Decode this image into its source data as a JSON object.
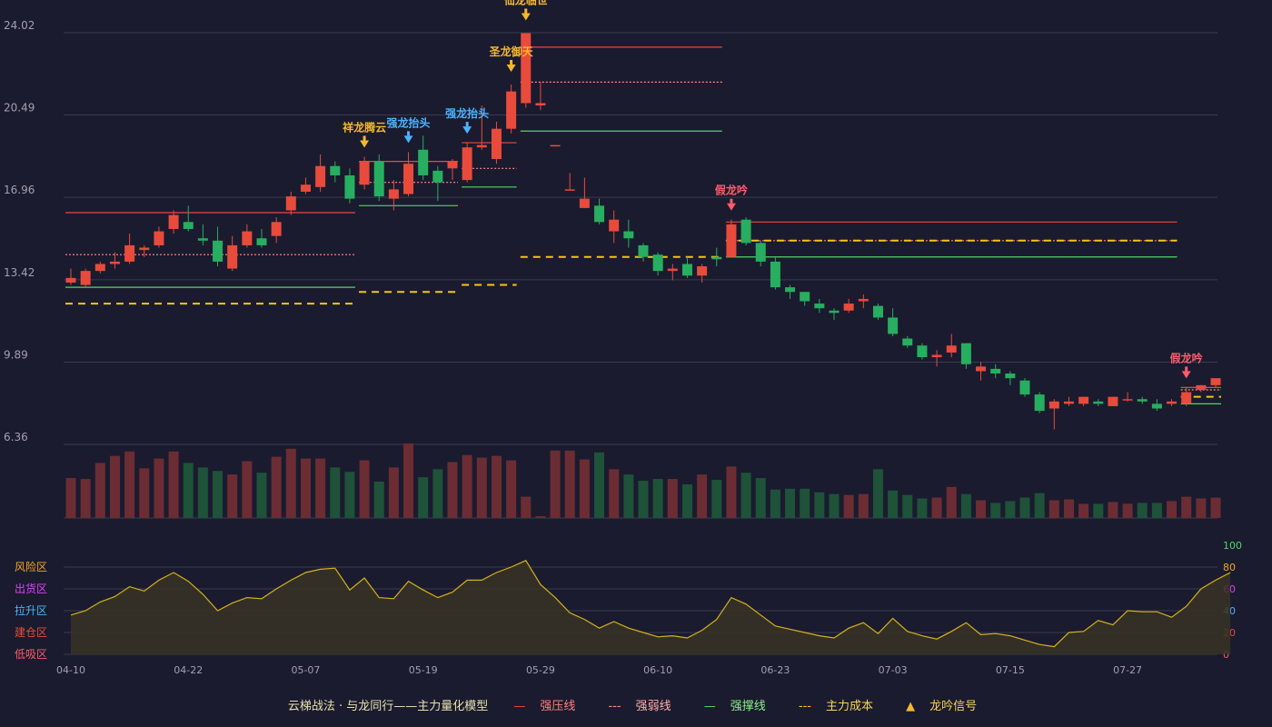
{
  "colors": {
    "background": "#1a1b2e",
    "up": "#e84b3c",
    "down": "#27ae60",
    "vol_up": "#6b2d33",
    "vol_down": "#1e5239",
    "pressure": "#e84b3c",
    "weak": "#ff8a8a",
    "support": "#4cd964",
    "cost": "#f5c518",
    "signal_gold": "#f5b82e",
    "signal_blue": "#4db2ff",
    "signal_red": "#ff5c6c",
    "osc_line": "#d4b21c",
    "grid": "#3a3b4e",
    "axis_text": "#a0a0b0"
  },
  "chart_data": {
    "type": "candlestick",
    "y_ticks": [
      "24.02",
      "20.49",
      "16.96",
      "13.42",
      "9.89",
      "6.36"
    ],
    "ylim": [
      6.36,
      24.02
    ],
    "x_labels": [
      {
        "index": 0,
        "label": "04-10"
      },
      {
        "index": 8,
        "label": "04-22"
      },
      {
        "index": 16,
        "label": "05-07"
      },
      {
        "index": 24,
        "label": "05-19"
      },
      {
        "index": 32,
        "label": "05-29"
      },
      {
        "index": 40,
        "label": "06-10"
      },
      {
        "index": 48,
        "label": "06-23"
      },
      {
        "index": 56,
        "label": "07-03"
      },
      {
        "index": 64,
        "label": "07-15"
      },
      {
        "index": 72,
        "label": "07-27"
      }
    ],
    "candles": [
      [
        13.3,
        13.5,
        13.9,
        13.2
      ],
      [
        13.2,
        13.8,
        13.9,
        13.1
      ],
      [
        13.8,
        14.1,
        14.2,
        13.7
      ],
      [
        14.1,
        14.2,
        14.6,
        13.9
      ],
      [
        14.2,
        14.9,
        15.4,
        14.1
      ],
      [
        14.7,
        14.8,
        14.9,
        14.4
      ],
      [
        14.9,
        15.5,
        15.7,
        14.8
      ],
      [
        15.6,
        16.2,
        16.4,
        15.4
      ],
      [
        15.9,
        15.6,
        16.6,
        15.5
      ],
      [
        15.2,
        15.1,
        15.8,
        14.9
      ],
      [
        15.1,
        14.2,
        15.7,
        14.0
      ],
      [
        13.9,
        14.9,
        15.3,
        13.8
      ],
      [
        14.9,
        15.5,
        15.8,
        14.8
      ],
      [
        15.2,
        14.9,
        15.6,
        14.8
      ],
      [
        15.3,
        15.9,
        16.1,
        15.0
      ],
      [
        16.4,
        17.0,
        17.2,
        16.2
      ],
      [
        17.2,
        17.5,
        17.8,
        17.1
      ],
      [
        17.4,
        18.3,
        18.8,
        17.2
      ],
      [
        18.3,
        17.9,
        18.5,
        17.6
      ],
      [
        17.9,
        16.9,
        18.2,
        16.7
      ],
      [
        17.5,
        18.5,
        18.7,
        17.3
      ],
      [
        18.5,
        17.0,
        18.8,
        16.8
      ],
      [
        16.9,
        17.3,
        17.7,
        16.4
      ],
      [
        17.1,
        18.4,
        18.9,
        17.0
      ],
      [
        19.0,
        17.9,
        19.6,
        17.7
      ],
      [
        18.1,
        17.6,
        18.3,
        16.8
      ],
      [
        18.2,
        18.5,
        18.6,
        17.7
      ],
      [
        17.7,
        19.1,
        19.3,
        17.6
      ],
      [
        19.1,
        19.2,
        20.9,
        19.0
      ],
      [
        18.6,
        19.9,
        20.2,
        18.4
      ],
      [
        19.9,
        21.5,
        21.8,
        19.7
      ],
      [
        21.0,
        24.0,
        24.0,
        20.8
      ],
      [
        20.9,
        21.0,
        21.9,
        20.7
      ],
      [
        19.2,
        19.2,
        19.2,
        19.2
      ],
      [
        17.3,
        17.3,
        18.0,
        17.3
      ],
      [
        16.5,
        16.9,
        17.8,
        16.5
      ],
      [
        16.6,
        15.9,
        16.9,
        15.8
      ],
      [
        15.5,
        16.0,
        16.4,
        15.0
      ],
      [
        15.5,
        15.2,
        16.0,
        14.8
      ],
      [
        14.9,
        14.4,
        15.0,
        14.2
      ],
      [
        14.5,
        13.8,
        14.6,
        13.6
      ],
      [
        13.8,
        13.9,
        14.1,
        13.4
      ],
      [
        14.1,
        13.6,
        14.4,
        13.5
      ],
      [
        13.6,
        14.0,
        14.1,
        13.3
      ],
      [
        14.4,
        14.3,
        14.8,
        14.0
      ],
      [
        14.4,
        15.8,
        16.0,
        14.4
      ],
      [
        16.0,
        15.0,
        16.1,
        14.9
      ],
      [
        15.0,
        14.2,
        15.1,
        14.0
      ],
      [
        14.2,
        13.1,
        14.4,
        13.0
      ],
      [
        13.1,
        12.9,
        13.2,
        12.6
      ],
      [
        12.9,
        12.5,
        12.9,
        12.3
      ],
      [
        12.4,
        12.2,
        12.6,
        12.0
      ],
      [
        12.1,
        12.0,
        12.2,
        11.7
      ],
      [
        12.1,
        12.4,
        12.6,
        12.0
      ],
      [
        12.5,
        12.6,
        12.8,
        12.2
      ],
      [
        12.3,
        11.8,
        12.4,
        11.7
      ],
      [
        11.8,
        11.1,
        12.2,
        11.0
      ],
      [
        10.9,
        10.6,
        11.0,
        10.5
      ],
      [
        10.6,
        10.1,
        10.7,
        10.0
      ],
      [
        10.1,
        10.2,
        10.4,
        9.7
      ],
      [
        10.3,
        10.6,
        11.1,
        10.1
      ],
      [
        10.7,
        9.8,
        10.7,
        9.6
      ],
      [
        9.5,
        9.7,
        9.9,
        9.1
      ],
      [
        9.6,
        9.4,
        9.8,
        9.2
      ],
      [
        9.4,
        9.2,
        9.5,
        8.9
      ],
      [
        9.1,
        8.5,
        9.2,
        8.4
      ],
      [
        8.5,
        7.8,
        8.6,
        7.7
      ],
      [
        7.9,
        8.2,
        8.3,
        7.0
      ],
      [
        8.1,
        8.2,
        8.4,
        8.0
      ],
      [
        8.1,
        8.4,
        8.4,
        8.0
      ],
      [
        8.2,
        8.1,
        8.3,
        8.0
      ],
      [
        8.0,
        8.4,
        8.4,
        8.0
      ],
      [
        8.3,
        8.3,
        8.6,
        8.2
      ],
      [
        8.3,
        8.2,
        8.4,
        8.1
      ],
      [
        8.1,
        7.9,
        8.3,
        7.8
      ],
      [
        8.1,
        8.2,
        8.3,
        8.0
      ],
      [
        8.1,
        8.6,
        8.8,
        8.0
      ],
      [
        8.7,
        8.9,
        8.9,
        8.6
      ],
      [
        8.9,
        9.2,
        9.2,
        8.8
      ]
    ],
    "volume": [
      45,
      44,
      62,
      70,
      75,
      56,
      67,
      75,
      62,
      57,
      53,
      49,
      64,
      51,
      69,
      78,
      67,
      67,
      57,
      52,
      65,
      41,
      57,
      84,
      46,
      55,
      63,
      71,
      68,
      70,
      65,
      24,
      2,
      76,
      76,
      66,
      74,
      55,
      49,
      42,
      44,
      44,
      38,
      49,
      43,
      58,
      51,
      45,
      32,
      33,
      33,
      29,
      27,
      26,
      27,
      55,
      31,
      26,
      22,
      23,
      35,
      27,
      20,
      17,
      19,
      23,
      28,
      20,
      21,
      16,
      16,
      18,
      16,
      17,
      17,
      19,
      24,
      22,
      23
    ],
    "oscillator": [
      36,
      40,
      48,
      53,
      62,
      58,
      68,
      75,
      67,
      55,
      40,
      47,
      52,
      51,
      60,
      68,
      75,
      78,
      79,
      59,
      70,
      52,
      51,
      67,
      59,
      52,
      57,
      68,
      68,
      75,
      80,
      86,
      64,
      52,
      38,
      32,
      24,
      30,
      24,
      20,
      16,
      17,
      15,
      22,
      32,
      52,
      46,
      36,
      26,
      23,
      20,
      17,
      15,
      24,
      29,
      19,
      33,
      21,
      17,
      14,
      21,
      29,
      18,
      19,
      17,
      13,
      9,
      7,
      20,
      21,
      31,
      27,
      40,
      39,
      39,
      34,
      44,
      60,
      68,
      75
    ],
    "osc_ylim": [
      0,
      100
    ],
    "osc_ticks": [
      0,
      20,
      40,
      60,
      80,
      100
    ],
    "osc_zones": [
      "风险区",
      "出货区",
      "拉升区",
      "建仓区",
      "低吸区"
    ],
    "levels": [
      {
        "kind": "pressure",
        "start": 0,
        "end": 19,
        "value": 16.3
      },
      {
        "kind": "weak",
        "start": 0,
        "end": 19,
        "value": 14.5
      },
      {
        "kind": "support",
        "start": 0,
        "end": 19,
        "value": 13.1
      },
      {
        "kind": "cost",
        "start": 0,
        "end": 19,
        "value": 12.4
      },
      {
        "kind": "pressure",
        "start": 20,
        "end": 26,
        "value": 18.5
      },
      {
        "kind": "weak",
        "start": 20,
        "end": 26,
        "value": 17.6
      },
      {
        "kind": "support",
        "start": 20,
        "end": 26,
        "value": 16.6
      },
      {
        "kind": "cost",
        "start": 20,
        "end": 26,
        "value": 12.9
      },
      {
        "kind": "pressure",
        "start": 27,
        "end": 30,
        "value": 19.3
      },
      {
        "kind": "weak",
        "start": 27,
        "end": 30,
        "value": 18.2
      },
      {
        "kind": "support",
        "start": 27,
        "end": 30,
        "value": 17.4
      },
      {
        "kind": "cost",
        "start": 27,
        "end": 30,
        "value": 13.2
      },
      {
        "kind": "pressure",
        "start": 31,
        "end": 44,
        "value": 23.4
      },
      {
        "kind": "weak",
        "start": 31,
        "end": 44,
        "value": 21.9
      },
      {
        "kind": "support",
        "start": 31,
        "end": 44,
        "value": 19.8
      },
      {
        "kind": "cost",
        "start": 31,
        "end": 44,
        "value": 14.4
      },
      {
        "kind": "pressure",
        "start": 45,
        "end": 75,
        "value": 15.9
      },
      {
        "kind": "weak",
        "start": 45,
        "end": 75,
        "value": 15.1
      },
      {
        "kind": "support",
        "start": 45,
        "end": 75,
        "value": 14.4
      },
      {
        "kind": "cost",
        "start": 45,
        "end": 75,
        "value": 15.1
      },
      {
        "kind": "pressure",
        "start": 76,
        "end": 78,
        "value": 8.8
      },
      {
        "kind": "weak",
        "start": 76,
        "end": 78,
        "value": 8.7
      },
      {
        "kind": "support",
        "start": 76,
        "end": 78,
        "value": 8.1
      },
      {
        "kind": "cost",
        "start": 76,
        "end": 78,
        "value": 8.4
      }
    ],
    "signals": [
      {
        "index": 20,
        "label": "祥龙腾云",
        "color": "signal_gold",
        "tier": "low"
      },
      {
        "index": 23,
        "label": "强龙抬头",
        "color": "signal_blue",
        "tier": "low"
      },
      {
        "index": 27,
        "label": "强龙抬头",
        "color": "signal_blue",
        "tier": "low"
      },
      {
        "index": 30,
        "label": "圣龙御天",
        "color": "signal_gold",
        "tier": "mid"
      },
      {
        "index": 31,
        "label": "仙龙临世",
        "color": "signal_gold",
        "tier": "high"
      },
      {
        "index": 45,
        "label": "假龙吟",
        "color": "signal_red",
        "tier": "low"
      },
      {
        "index": 76,
        "label": "假龙吟",
        "color": "signal_red",
        "tier": "low"
      }
    ]
  },
  "legend": {
    "title": "云梯战法 · 与龙同行——主力量化模型",
    "items": [
      {
        "label": "强压线",
        "mark": "—",
        "color": "pressure"
      },
      {
        "label": "强弱线",
        "mark": "---",
        "color": "weak"
      },
      {
        "label": "强撑线",
        "mark": "—",
        "color": "support"
      },
      {
        "label": "主力成本",
        "mark": "---",
        "color": "cost"
      },
      {
        "label": "龙吟信号",
        "mark": "▲",
        "color": "signal_gold"
      }
    ]
  }
}
